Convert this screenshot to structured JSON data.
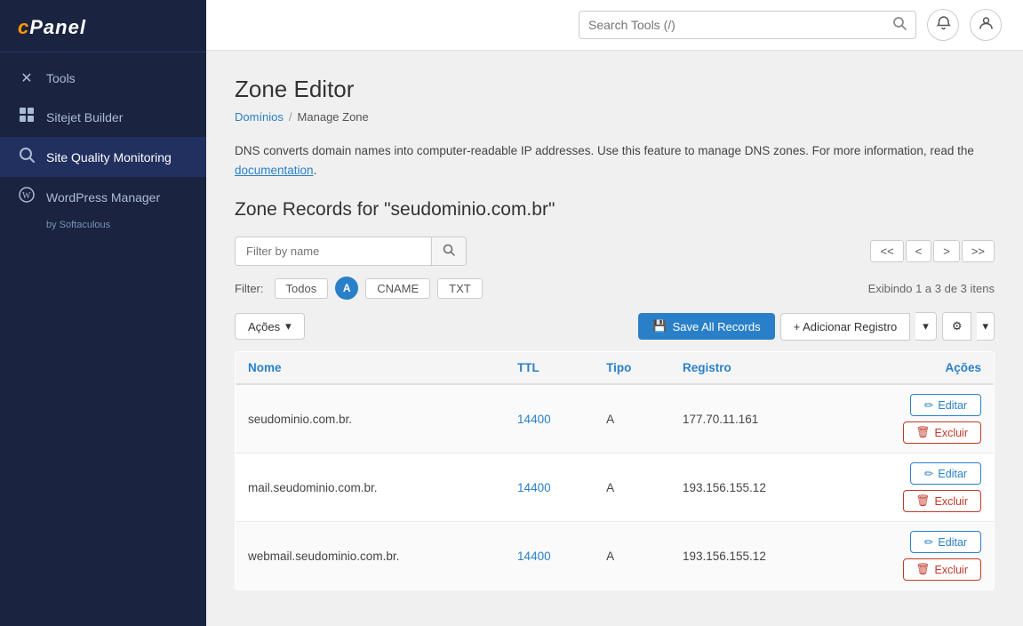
{
  "sidebar": {
    "logo": "cPanel",
    "items": [
      {
        "id": "tools",
        "label": "Tools",
        "icon": "✕"
      },
      {
        "id": "sitejet",
        "label": "Sitejet Builder",
        "icon": "⬜"
      },
      {
        "id": "site-quality",
        "label": "Site Quality Monitoring",
        "icon": "🔍"
      },
      {
        "id": "wordpress",
        "label": "WordPress Manager",
        "sublabel": "by Softaculous",
        "icon": "Ⓦ"
      }
    ]
  },
  "topbar": {
    "search_placeholder": "Search Tools (/)",
    "search_icon": "search",
    "bell_icon": "bell",
    "user_icon": "user"
  },
  "page": {
    "title": "Zone Editor",
    "breadcrumb_link": "Domínios",
    "breadcrumb_sep": "/",
    "breadcrumb_current": "Manage Zone",
    "description_text": "DNS converts domain names into computer-readable IP addresses. Use this feature to manage DNS zones. For more information, read the",
    "description_link_text": "documentation",
    "description_end": ".",
    "zone_records_title": "Zone Records for \"seudominio.com.br\""
  },
  "filter": {
    "placeholder": "Filter by name",
    "label": "Filter:",
    "tags": [
      {
        "id": "todos",
        "label": "Todos",
        "active": false
      },
      {
        "id": "a",
        "label": "A",
        "active": true
      },
      {
        "id": "cname",
        "label": "CNAME",
        "active": false
      },
      {
        "id": "txt",
        "label": "TXT",
        "active": false
      }
    ],
    "exibindo": "Exibindo 1 a 3 de 3 itens"
  },
  "actions": {
    "acoes_label": "Ações",
    "save_all_label": "Save All Records",
    "save_icon": "💾",
    "add_record_label": "+ Adicionar Registro",
    "gear_icon": "⚙"
  },
  "table": {
    "headers": [
      "Nome",
      "TTL",
      "Tipo",
      "Registro",
      "Ações"
    ],
    "rows": [
      {
        "nome": "seudominio.com.br.",
        "ttl": "14400",
        "tipo": "A",
        "registro": "177.70.11.161",
        "edit_label": "Editar",
        "delete_label": "Excluir"
      },
      {
        "nome": "mail.seudominio.com.br.",
        "ttl": "14400",
        "tipo": "A",
        "registro": "193.156.155.12",
        "edit_label": "Editar",
        "delete_label": "Excluir"
      },
      {
        "nome": "webmail.seudominio.com.br.",
        "ttl": "14400",
        "tipo": "A",
        "registro": "193.156.155.12",
        "edit_label": "Editar",
        "delete_label": "Excluir"
      }
    ]
  },
  "pagination": {
    "first": "<<",
    "prev": "<",
    "next": ">",
    "last": ">>"
  }
}
